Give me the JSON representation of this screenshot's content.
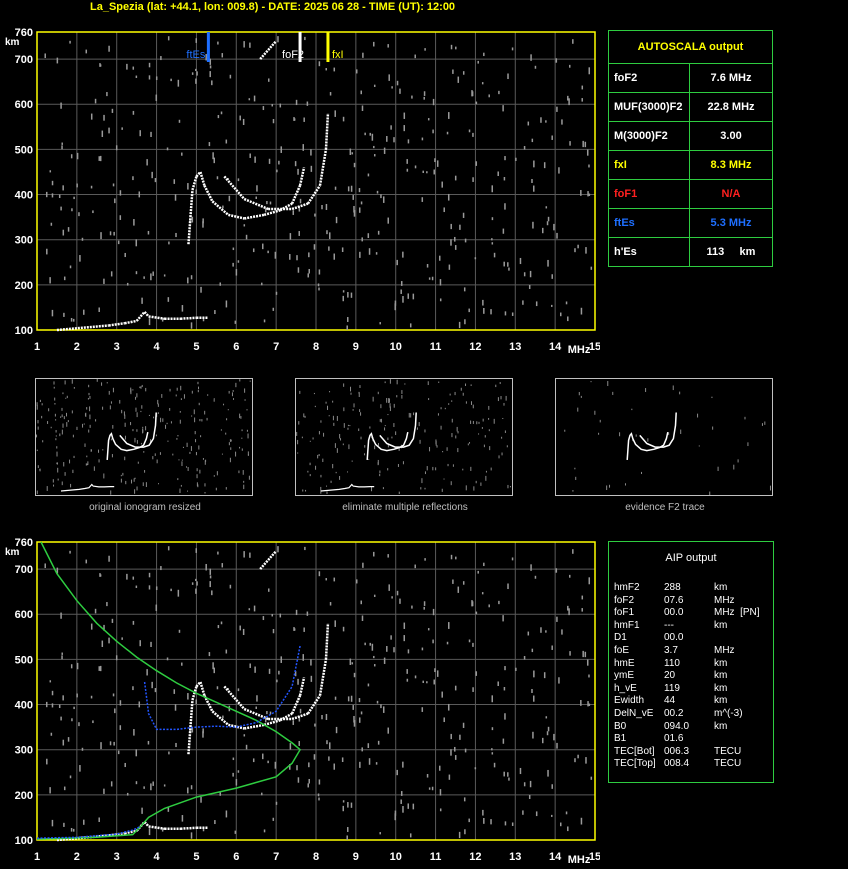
{
  "header": "La_Spezia (lat: +44.1, lon: 009.8) - DATE: 2025 06 28 - TIME (UT): 12:00",
  "colors": {
    "grid": "#5a5a5a",
    "axis": "#ffff00",
    "green": "#2ecc40",
    "blue": "#2255ff",
    "esblue": "#1e6fff",
    "fxl": "#ffff00",
    "red": "#ff2020"
  },
  "axes": {
    "y_unit": "km",
    "x_unit": "MHz",
    "y_ticks": [
      "100",
      "200",
      "300",
      "400",
      "500",
      "600",
      "700",
      "760"
    ],
    "x_ticks": [
      "1",
      "2",
      "3",
      "4",
      "5",
      "6",
      "7",
      "8",
      "9",
      "10",
      "11",
      "12",
      "13",
      "14",
      "15"
    ],
    "xlim": [
      1,
      15
    ],
    "ylim": [
      100,
      760
    ]
  },
  "markers": {
    "ftEs": {
      "label": "ftEs",
      "value": 5.3
    },
    "foF2": {
      "label": "foF2",
      "value": 7.6
    },
    "fxI": {
      "label": "fxI",
      "value": 8.3
    }
  },
  "autoscala": {
    "title": "AUTOSCALA output",
    "rows": [
      {
        "name": "foF2",
        "value": "7.6 MHz",
        "color": "#ffffff"
      },
      {
        "name": "MUF(3000)F2",
        "value": "22.8 MHz",
        "color": "#ffffff"
      },
      {
        "name": "M(3000)F2",
        "value": "3.00",
        "color": "#ffffff"
      },
      {
        "name": "fxI",
        "value": "8.3 MHz",
        "color": "#ffff00"
      },
      {
        "name": "foF1",
        "value": "N/A",
        "color": "#ff2020"
      },
      {
        "name": "ftEs",
        "value": "5.3 MHz",
        "color": "#1e6fff"
      },
      {
        "name": "h'Es",
        "value": "113",
        "unit": "km",
        "color": "#ffffff"
      }
    ]
  },
  "thumbs": [
    {
      "caption": "original ionogram resized"
    },
    {
      "caption": "eliminate multiple reflections"
    },
    {
      "caption": "evidence F2 trace"
    }
  ],
  "aip": {
    "title": "AIP output",
    "rows": [
      [
        "hmF2",
        "288",
        "km"
      ],
      [
        "foF2",
        "07.6",
        "MHz"
      ],
      [
        "foF1",
        "00.0",
        "MHz  [PN]"
      ],
      [
        "hmF1",
        "---",
        "km"
      ],
      [
        "D1",
        "00.0",
        ""
      ],
      [
        "foE",
        "3.7",
        "MHz"
      ],
      [
        "hmE",
        "110",
        "km"
      ],
      [
        "ymE",
        "20",
        "km"
      ],
      [
        "h_vE",
        "119",
        "km"
      ],
      [
        "Ewidth",
        "44",
        "km"
      ],
      [
        "DelN_vE",
        "00.2",
        "m^(-3)"
      ],
      [
        "B0",
        "094.0",
        "km"
      ],
      [
        "B1",
        "01.6",
        ""
      ],
      [
        "TEC[Bot]",
        "006.3",
        "TECU"
      ],
      [
        "TEC[Top]",
        "008.4",
        "TECU"
      ]
    ]
  },
  "chart_data": [
    {
      "type": "scatter",
      "title": "",
      "xlabel": "MHz",
      "ylabel": "km",
      "xlim": [
        1,
        15
      ],
      "ylim": [
        100,
        760
      ],
      "series": [
        {
          "name": "",
          "color": "#ffffff",
          "points": [
            [
              1.5,
              100
            ],
            [
              2.8,
              110
            ],
            [
              3.2,
              115
            ],
            [
              3.5,
              120
            ],
            [
              3.7,
              140
            ],
            [
              3.8,
              130
            ],
            [
              4.2,
              125
            ],
            [
              4.6,
              125
            ],
            [
              5.0,
              127
            ],
            [
              5.3,
              127
            ]
          ]
        },
        {
          "name": "",
          "color": "#ffffff",
          "points": [
            [
              4.8,
              290
            ],
            [
              4.85,
              350
            ],
            [
              4.9,
              410
            ],
            [
              5.0,
              440
            ],
            [
              5.1,
              450
            ],
            [
              5.2,
              420
            ],
            [
              5.4,
              385
            ],
            [
              5.8,
              355
            ],
            [
              6.2,
              347
            ],
            [
              6.7,
              355
            ],
            [
              7.1,
              365
            ],
            [
              7.4,
              380
            ],
            [
              7.6,
              420
            ],
            [
              7.7,
              460
            ]
          ]
        },
        {
          "name": "",
          "color": "#ffffff",
          "points": [
            [
              5.7,
              440
            ],
            [
              6.2,
              390
            ],
            [
              6.8,
              368
            ],
            [
              7.4,
              368
            ],
            [
              7.8,
              380
            ],
            [
              8.1,
              420
            ],
            [
              8.25,
              500
            ],
            [
              8.3,
              580
            ]
          ]
        },
        {
          "name": "",
          "color": "#ffffff",
          "points": [
            [
              6.6,
              700
            ],
            [
              6.8,
              720
            ],
            [
              7.0,
              740
            ]
          ]
        }
      ]
    },
    {
      "type": "line",
      "title": "",
      "xlabel": "MHz",
      "ylabel": "km",
      "xlim": [
        1,
        15
      ],
      "ylim": [
        100,
        760
      ],
      "series": [
        {
          "name": "",
          "color": "#2ecc40",
          "points": [
            [
              1.1,
              760
            ],
            [
              1.5,
              690
            ],
            [
              2.0,
              630
            ],
            [
              2.5,
              580
            ],
            [
              3.0,
              540
            ],
            [
              3.5,
              505
            ],
            [
              4.0,
              475
            ],
            [
              4.5,
              448
            ],
            [
              5.0,
              425
            ],
            [
              5.5,
              405
            ],
            [
              6.0,
              385
            ],
            [
              6.5,
              365
            ],
            [
              7.0,
              340
            ],
            [
              7.4,
              315
            ],
            [
              7.6,
              300
            ],
            [
              7.4,
              270
            ],
            [
              7.0,
              240
            ],
            [
              6.0,
              215
            ],
            [
              5.0,
              195
            ],
            [
              4.2,
              170
            ],
            [
              3.8,
              150
            ],
            [
              3.6,
              130
            ],
            [
              3.4,
              112
            ],
            [
              2.5,
              106
            ],
            [
              1.5,
              103
            ],
            [
              1.0,
              102
            ]
          ]
        },
        {
          "name": "",
          "color": "#2255ff",
          "points": [
            [
              3.7,
              450
            ],
            [
              3.8,
              380
            ],
            [
              4.0,
              345
            ],
            [
              4.5,
              345
            ],
            [
              5.0,
              350
            ],
            [
              5.5,
              352
            ],
            [
              6.0,
              350
            ],
            [
              6.5,
              360
            ],
            [
              7.0,
              385
            ],
            [
              7.4,
              440
            ],
            [
              7.6,
              530
            ]
          ]
        },
        {
          "name": "",
          "color": "#2255ff",
          "points": [
            [
              1.0,
              104
            ],
            [
              2.0,
              106
            ],
            [
              3.0,
              113
            ],
            [
              3.4,
              122
            ],
            [
              3.6,
              130
            ]
          ]
        }
      ]
    }
  ]
}
